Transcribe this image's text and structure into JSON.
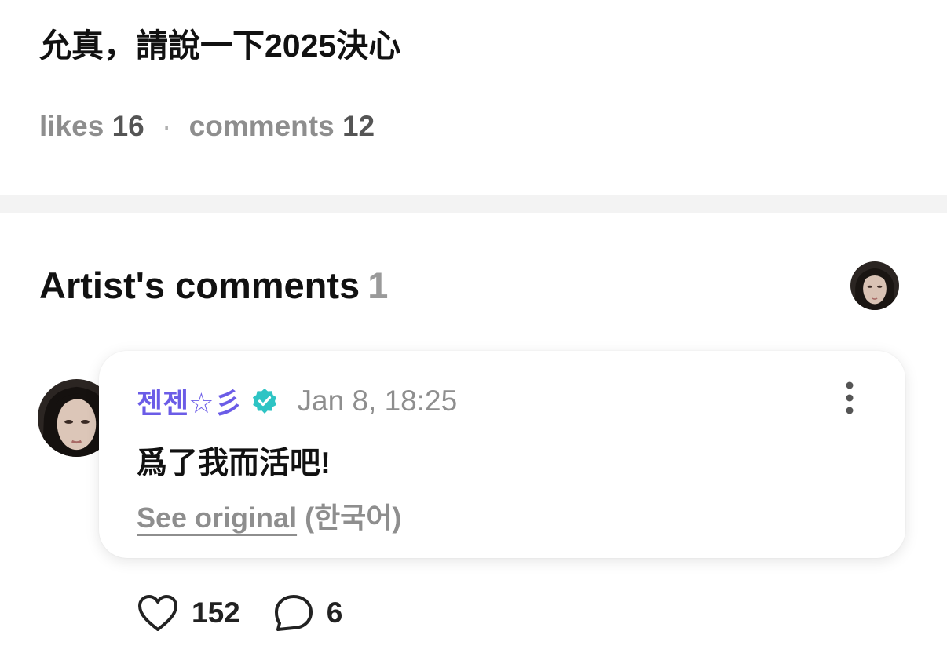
{
  "post": {
    "title": "允真，請說一下2025決心",
    "likes_label": "likes",
    "likes_count": "16",
    "comments_label": "comments",
    "comments_count": "12"
  },
  "artist_comments": {
    "title": "Artist's comments",
    "count": "1"
  },
  "comment": {
    "author": "젠젠☆彡",
    "timestamp": "Jan 8, 18:25",
    "text": "爲了我而活吧!",
    "see_original_label": "See original",
    "original_language": "(한국어)",
    "like_count": "152",
    "reply_count": "6"
  },
  "icons": {
    "verified": "verified-badge-icon",
    "more": "more-vertical-icon",
    "like": "heart-icon",
    "reply": "comment-bubble-icon"
  },
  "colors": {
    "author_name": "#6b5ce7",
    "verified_badge": "#2ec4c4",
    "muted_text": "#8e8e8e",
    "divider": "#f3f3f3"
  }
}
